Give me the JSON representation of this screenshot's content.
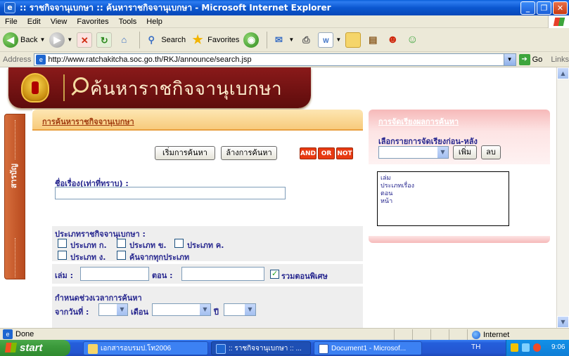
{
  "window": {
    "title": ":: ราชกิจจานุเบกษา :: ค้นหาราชกิจจานุเบกษา - Microsoft Internet Explorer"
  },
  "menu": [
    "File",
    "Edit",
    "View",
    "Favorites",
    "Tools",
    "Help"
  ],
  "toolbar": {
    "back_label": "Back",
    "search_label": "Search",
    "favorites_label": "Favorites"
  },
  "address": {
    "label": "Address",
    "url": "http://www.ratchakitcha.soc.go.th/RKJ/announce/search.jsp",
    "go_label": "Go",
    "links_label": "Links"
  },
  "banner": {
    "title": "ค้นหาราชกิจจานุเบกษา"
  },
  "sidetab": {
    "label": "สารบัญ"
  },
  "search_panel": {
    "title": "การค้นหาราชกิจจานุเบกษา",
    "start_button": "เริ่มการค้นหา",
    "clear_button": "ล้างการค้นหา",
    "logic": [
      "AND",
      "OR",
      "NOT"
    ],
    "subject_label": "ชื่อเรื่อง(เท่าที่ทราบ) :",
    "subject_value": "",
    "type_section_label": "ประเภทราชกิจจานุเบกษา :",
    "types": [
      {
        "label": "ประเภท ก.",
        "checked": false
      },
      {
        "label": "ประเภท ข.",
        "checked": false
      },
      {
        "label": "ประเภท ค.",
        "checked": false
      },
      {
        "label": "ประเภท ง.",
        "checked": false
      },
      {
        "label": "ค้นจากทุกประเภท",
        "checked": false
      }
    ],
    "volume_label": "เล่ม :",
    "volume_value": "",
    "issue_label": "ตอน :",
    "issue_value": "",
    "special_issue_label": "รวมตอนพิเศษ",
    "special_issue_checked": true,
    "date_section_label": "กำหนดช่วงเวลาการค้นหา",
    "from_date_label": "จากวันที่ :",
    "month_label": "เดือน",
    "year_label": "ปี",
    "from_day_value": "",
    "from_month_value": "",
    "from_year_value": ""
  },
  "sort_panel": {
    "title": "การจัดเรียงผลการค้นหา",
    "subtitle": "เลือกรายการจัดเรียงก่อน-หลัง",
    "add_button": "เพิ่ม",
    "delete_button": "ลบ",
    "select_value": "",
    "items": [
      "เล่ม",
      "ประเภทเรื่อง",
      "ตอน",
      "หน้า"
    ]
  },
  "status": {
    "text": "Done",
    "zone": "Internet"
  },
  "taskbar": {
    "start_label": "start",
    "tasks": [
      {
        "label": "เอกสารอบรมป.โท2006"
      },
      {
        "label": ":: ราชกิจจานุเบกษา :: ..."
      },
      {
        "label": "Document1 - Microsof..."
      }
    ],
    "language": "TH",
    "clock": "9:06"
  }
}
